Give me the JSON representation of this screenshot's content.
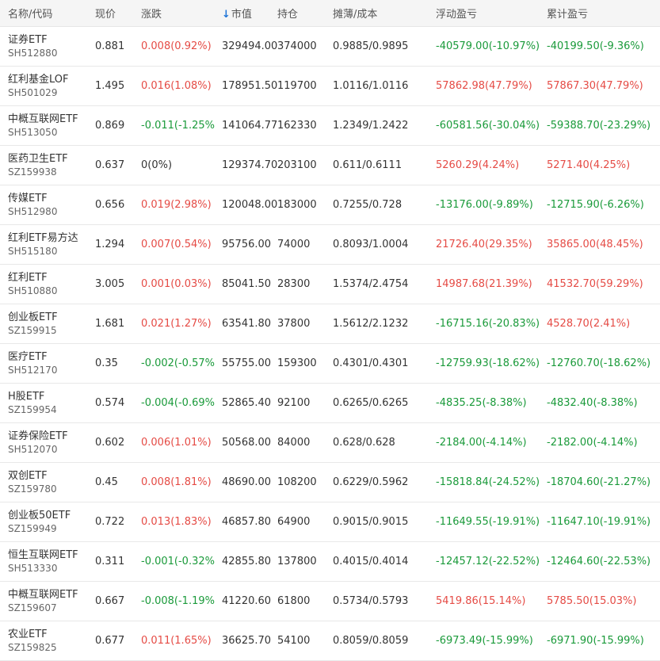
{
  "headers": {
    "name": "名称/代码",
    "price": "现价",
    "change": "涨跌",
    "market_value": "市值",
    "holdings": "持仓",
    "cost": "摊薄/成本",
    "floating_pl": "浮动盈亏",
    "cumulative_pl": "累计盈亏",
    "sort_icon": "↓"
  },
  "colors": {
    "up": "#e54b45",
    "down": "#1a9a3a",
    "header_bg": "#f5f5f5",
    "sort_arrow": "#1e74d8"
  },
  "rows": [
    {
      "name": "证券ETF",
      "code": "SH512880",
      "price": "0.881",
      "change": "0.008(0.92%)",
      "change_dir": "up",
      "mv": "329494.00",
      "qty": "374000",
      "cost": "0.9885/0.9895",
      "float": "-40579.00(-10.97%)",
      "float_dir": "down",
      "cum": "-40199.50(-9.36%)",
      "cum_dir": "down"
    },
    {
      "name": "红利基金LOF",
      "code": "SH501029",
      "price": "1.495",
      "change": "0.016(1.08%)",
      "change_dir": "up",
      "mv": "178951.50",
      "qty": "119700",
      "cost": "1.0116/1.0116",
      "float": "57862.98(47.79%)",
      "float_dir": "up",
      "cum": "57867.30(47.79%)",
      "cum_dir": "up"
    },
    {
      "name": "中概互联网ETF",
      "code": "SH513050",
      "price": "0.869",
      "change": "-0.011(-1.25%)",
      "change_dir": "down",
      "mv": "141064.77",
      "qty": "162330",
      "cost": "1.2349/1.2422",
      "float": "-60581.56(-30.04%)",
      "float_dir": "down",
      "cum": "-59388.70(-23.29%)",
      "cum_dir": "down"
    },
    {
      "name": "医药卫生ETF",
      "code": "SZ159938",
      "price": "0.637",
      "change": "0(0%)",
      "change_dir": "flat",
      "mv": "129374.70",
      "qty": "203100",
      "cost": "0.611/0.6111",
      "float": "5260.29(4.24%)",
      "float_dir": "up",
      "cum": "5271.40(4.25%)",
      "cum_dir": "up"
    },
    {
      "name": "传媒ETF",
      "code": "SH512980",
      "price": "0.656",
      "change": "0.019(2.98%)",
      "change_dir": "up",
      "mv": "120048.00",
      "qty": "183000",
      "cost": "0.7255/0.728",
      "float": "-13176.00(-9.89%)",
      "float_dir": "down",
      "cum": "-12715.90(-6.26%)",
      "cum_dir": "down"
    },
    {
      "name": "红利ETF易方达",
      "code": "SH515180",
      "price": "1.294",
      "change": "0.007(0.54%)",
      "change_dir": "up",
      "mv": "95756.00",
      "qty": "74000",
      "cost": "0.8093/1.0004",
      "float": "21726.40(29.35%)",
      "float_dir": "up",
      "cum": "35865.00(48.45%)",
      "cum_dir": "up"
    },
    {
      "name": "红利ETF",
      "code": "SH510880",
      "price": "3.005",
      "change": "0.001(0.03%)",
      "change_dir": "up",
      "mv": "85041.50",
      "qty": "28300",
      "cost": "1.5374/2.4754",
      "float": "14987.68(21.39%)",
      "float_dir": "up",
      "cum": "41532.70(59.29%)",
      "cum_dir": "up"
    },
    {
      "name": "创业板ETF",
      "code": "SZ159915",
      "price": "1.681",
      "change": "0.021(1.27%)",
      "change_dir": "up",
      "mv": "63541.80",
      "qty": "37800",
      "cost": "1.5612/2.1232",
      "float": "-16715.16(-20.83%)",
      "float_dir": "down",
      "cum": "4528.70(2.41%)",
      "cum_dir": "up"
    },
    {
      "name": "医疗ETF",
      "code": "SH512170",
      "price": "0.35",
      "change": "-0.002(-0.57%)",
      "change_dir": "down",
      "mv": "55755.00",
      "qty": "159300",
      "cost": "0.4301/0.4301",
      "float": "-12759.93(-18.62%)",
      "float_dir": "down",
      "cum": "-12760.70(-18.62%)",
      "cum_dir": "down"
    },
    {
      "name": "H股ETF",
      "code": "SZ159954",
      "price": "0.574",
      "change": "-0.004(-0.69%)",
      "change_dir": "down",
      "mv": "52865.40",
      "qty": "92100",
      "cost": "0.6265/0.6265",
      "float": "-4835.25(-8.38%)",
      "float_dir": "down",
      "cum": "-4832.40(-8.38%)",
      "cum_dir": "down"
    },
    {
      "name": "证券保险ETF",
      "code": "SH512070",
      "price": "0.602",
      "change": "0.006(1.01%)",
      "change_dir": "up",
      "mv": "50568.00",
      "qty": "84000",
      "cost": "0.628/0.628",
      "float": "-2184.00(-4.14%)",
      "float_dir": "down",
      "cum": "-2182.00(-4.14%)",
      "cum_dir": "down"
    },
    {
      "name": "双创ETF",
      "code": "SZ159780",
      "price": "0.45",
      "change": "0.008(1.81%)",
      "change_dir": "up",
      "mv": "48690.00",
      "qty": "108200",
      "cost": "0.6229/0.5962",
      "float": "-15818.84(-24.52%)",
      "float_dir": "down",
      "cum": "-18704.60(-21.27%)",
      "cum_dir": "down"
    },
    {
      "name": "创业板50ETF",
      "code": "SZ159949",
      "price": "0.722",
      "change": "0.013(1.83%)",
      "change_dir": "up",
      "mv": "46857.80",
      "qty": "64900",
      "cost": "0.9015/0.9015",
      "float": "-11649.55(-19.91%)",
      "float_dir": "down",
      "cum": "-11647.10(-19.91%)",
      "cum_dir": "down"
    },
    {
      "name": "恒生互联网ETF",
      "code": "SH513330",
      "price": "0.311",
      "change": "-0.001(-0.32%)",
      "change_dir": "down",
      "mv": "42855.80",
      "qty": "137800",
      "cost": "0.4015/0.4014",
      "float": "-12457.12(-22.52%)",
      "float_dir": "down",
      "cum": "-12464.60(-22.53%)",
      "cum_dir": "down"
    },
    {
      "name": "中概互联网ETF",
      "code": "SZ159607",
      "price": "0.667",
      "change": "-0.008(-1.19%)",
      "change_dir": "down",
      "mv": "41220.60",
      "qty": "61800",
      "cost": "0.5734/0.5793",
      "float": "5419.86(15.14%)",
      "float_dir": "up",
      "cum": "5785.50(15.03%)",
      "cum_dir": "up"
    },
    {
      "name": "农业ETF",
      "code": "SZ159825",
      "price": "0.677",
      "change": "0.011(1.65%)",
      "change_dir": "up",
      "mv": "36625.70",
      "qty": "54100",
      "cost": "0.8059/0.8059",
      "float": "-6973.49(-15.99%)",
      "float_dir": "down",
      "cum": "-6971.90(-15.99%)",
      "cum_dir": "down"
    }
  ]
}
